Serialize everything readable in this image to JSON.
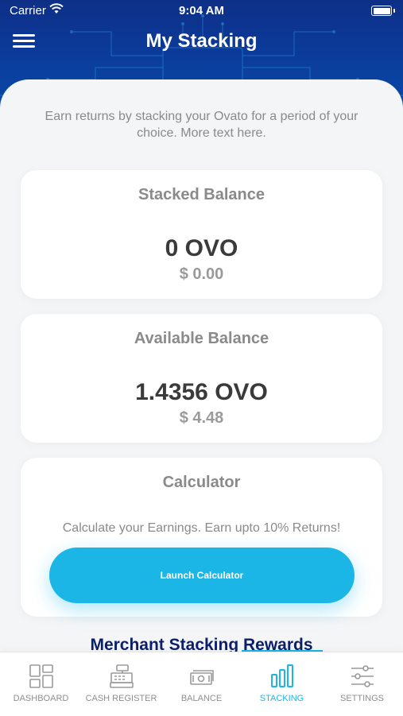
{
  "status_bar": {
    "carrier": "Carrier",
    "time": "9:04 AM",
    "battery_level": 1.0
  },
  "header": {
    "title": "My Stacking",
    "menu_icon": "hamburger-menu-icon"
  },
  "intro": {
    "text": "Earn returns by stacking your Ovato for a period of your choice. More text here."
  },
  "stacked": {
    "title": "Stacked Balance",
    "amount": "0 OVO",
    "usd": "$ 0.00"
  },
  "available": {
    "title": "Available Balance",
    "amount": "1.4356 OVO",
    "usd": "$ 4.48"
  },
  "calculator": {
    "title": "Calculator",
    "text": "Calculate your Earnings. Earn upto 10% Returns!",
    "button_label": "Launch Calculator"
  },
  "merchant": {
    "heading": "Merchant Stacking Rewards"
  },
  "nav": {
    "items": [
      {
        "label": "DASHBOARD",
        "icon": "dashboard-icon",
        "active": false
      },
      {
        "label": "CASH REGISTER",
        "icon": "cash-register-icon",
        "active": false
      },
      {
        "label": "BALANCE",
        "icon": "balance-icon",
        "active": false
      },
      {
        "label": "STACKING",
        "icon": "stacking-icon",
        "active": true
      },
      {
        "label": "SETTINGS",
        "icon": "settings-icon",
        "active": false
      }
    ]
  },
  "colors": {
    "accent": "#1bb6e6",
    "header": "#0b3a9a",
    "merchant_heading": "#0c1f6b"
  }
}
